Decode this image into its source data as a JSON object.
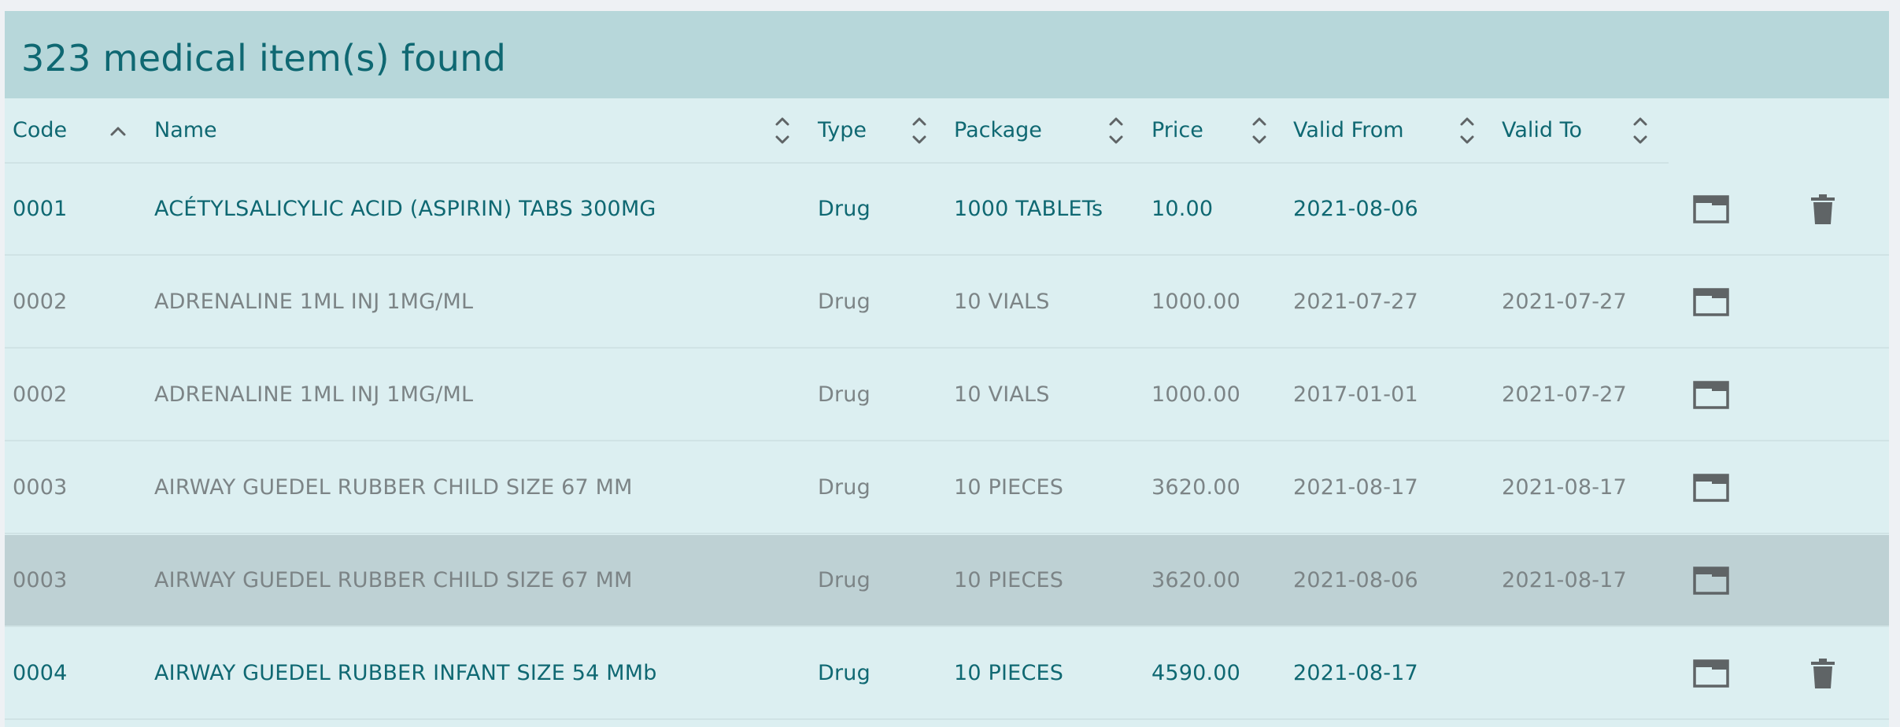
{
  "header": {
    "title": "323 medical item(s) found"
  },
  "columns": [
    {
      "key": "code",
      "label": "Code",
      "sort": "asc"
    },
    {
      "key": "name",
      "label": "Name",
      "sort": "none"
    },
    {
      "key": "type",
      "label": "Type",
      "sort": "none"
    },
    {
      "key": "package",
      "label": "Package",
      "sort": "none"
    },
    {
      "key": "price",
      "label": "Price",
      "sort": "none"
    },
    {
      "key": "valid_from",
      "label": "Valid From",
      "sort": "none"
    },
    {
      "key": "valid_to",
      "label": "Valid To",
      "sort": "none"
    }
  ],
  "icons": {
    "open": "open-window-icon",
    "delete": "trash-icon",
    "sort_asc": "chevron-up-icon",
    "sort_both": "sort-chevrons-icon"
  },
  "colors": {
    "accent": "#0f6872",
    "header_bg": "#b7d7da",
    "panel_bg": "#dceff1",
    "selected_row_bg": "#bed1d4",
    "inactive_text": "#7c8486",
    "icon": "#5f6466"
  },
  "rows": [
    {
      "code": "0001",
      "name": "ACÉTYLSALICYLIC ACID (ASPIRIN) TABS 300MG",
      "type": "Drug",
      "package": "1000 TABLETs",
      "price": "10.00",
      "valid_from": "2021-08-06",
      "valid_to": "",
      "status": "active",
      "selected": false,
      "deletable": true
    },
    {
      "code": "0002",
      "name": "ADRENALINE 1ML INJ 1MG/ML",
      "type": "Drug",
      "package": "10 VIALS",
      "price": "1000.00",
      "valid_from": "2021-07-27",
      "valid_to": "2021-07-27",
      "status": "inactive",
      "selected": false,
      "deletable": false
    },
    {
      "code": "0002",
      "name": "ADRENALINE 1ML INJ 1MG/ML",
      "type": "Drug",
      "package": "10 VIALS",
      "price": "1000.00",
      "valid_from": "2017-01-01",
      "valid_to": "2021-07-27",
      "status": "inactive",
      "selected": false,
      "deletable": false
    },
    {
      "code": "0003",
      "name": "AIRWAY GUEDEL RUBBER CHILD SIZE 67 MM",
      "type": "Drug",
      "package": "10 PIECES",
      "price": "3620.00",
      "valid_from": "2021-08-17",
      "valid_to": "2021-08-17",
      "status": "inactive",
      "selected": false,
      "deletable": false
    },
    {
      "code": "0003",
      "name": "AIRWAY GUEDEL RUBBER CHILD SIZE 67 MM",
      "type": "Drug",
      "package": "10 PIECES",
      "price": "3620.00",
      "valid_from": "2021-08-06",
      "valid_to": "2021-08-17",
      "status": "inactive",
      "selected": true,
      "deletable": false
    },
    {
      "code": "0004",
      "name": "AIRWAY GUEDEL RUBBER INFANT SIZE 54 MMb",
      "type": "Drug",
      "package": "10 PIECES",
      "price": "4590.00",
      "valid_from": "2021-08-17",
      "valid_to": "",
      "status": "active",
      "selected": false,
      "deletable": true
    }
  ]
}
